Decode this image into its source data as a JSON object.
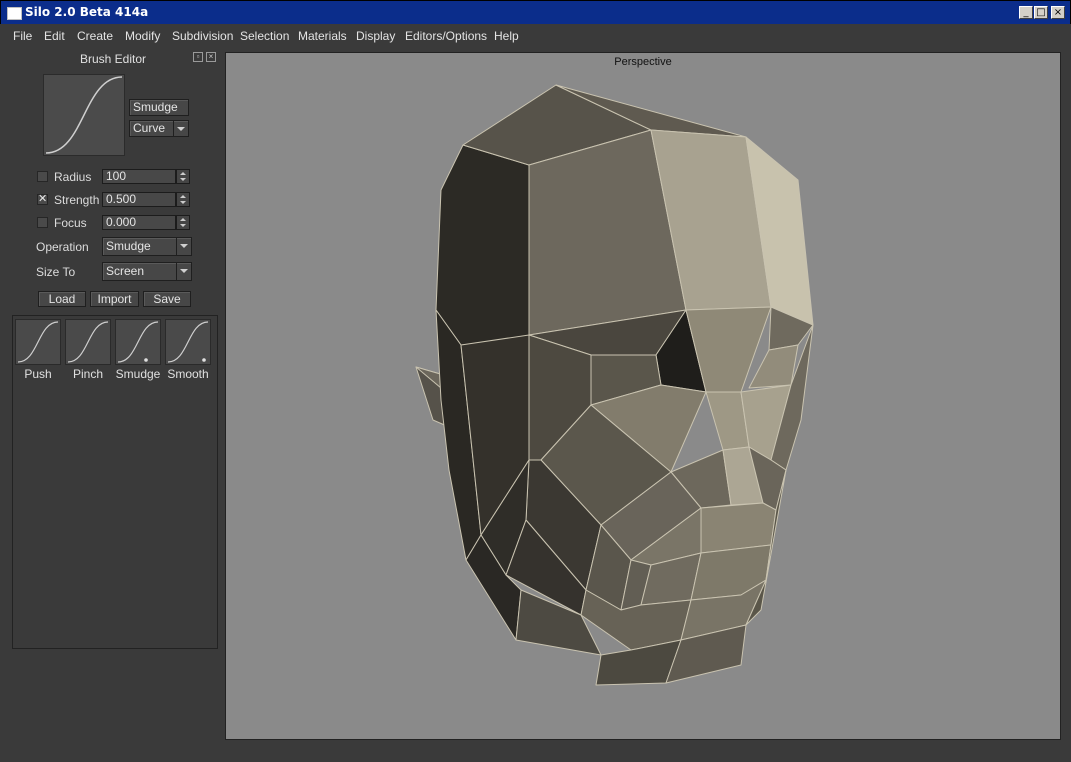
{
  "window": {
    "title": "Silo 2.0 Beta 414a"
  },
  "menu": [
    "File",
    "Edit",
    "Create",
    "Modify",
    "Subdivision",
    "Selection",
    "Materials",
    "Display",
    "Editors/Options",
    "Help"
  ],
  "brush_editor": {
    "title": "Brush Editor",
    "name_button": "Smudge",
    "falloff_dropdown": "Curve",
    "radius": {
      "label": "Radius",
      "value": "100",
      "checked": false
    },
    "strength": {
      "label": "Strength",
      "value": "0.500",
      "checked": true
    },
    "focus": {
      "label": "Focus",
      "value": "0.000",
      "checked": false
    },
    "operation": {
      "label": "Operation",
      "value": "Smudge"
    },
    "size_to": {
      "label": "Size To",
      "value": "Screen"
    },
    "buttons": {
      "load": "Load",
      "import": "Import",
      "save": "Save"
    },
    "brushes": [
      "Push",
      "Pinch",
      "Smudge",
      "Smooth"
    ]
  },
  "viewport": {
    "title": "Perspective"
  }
}
